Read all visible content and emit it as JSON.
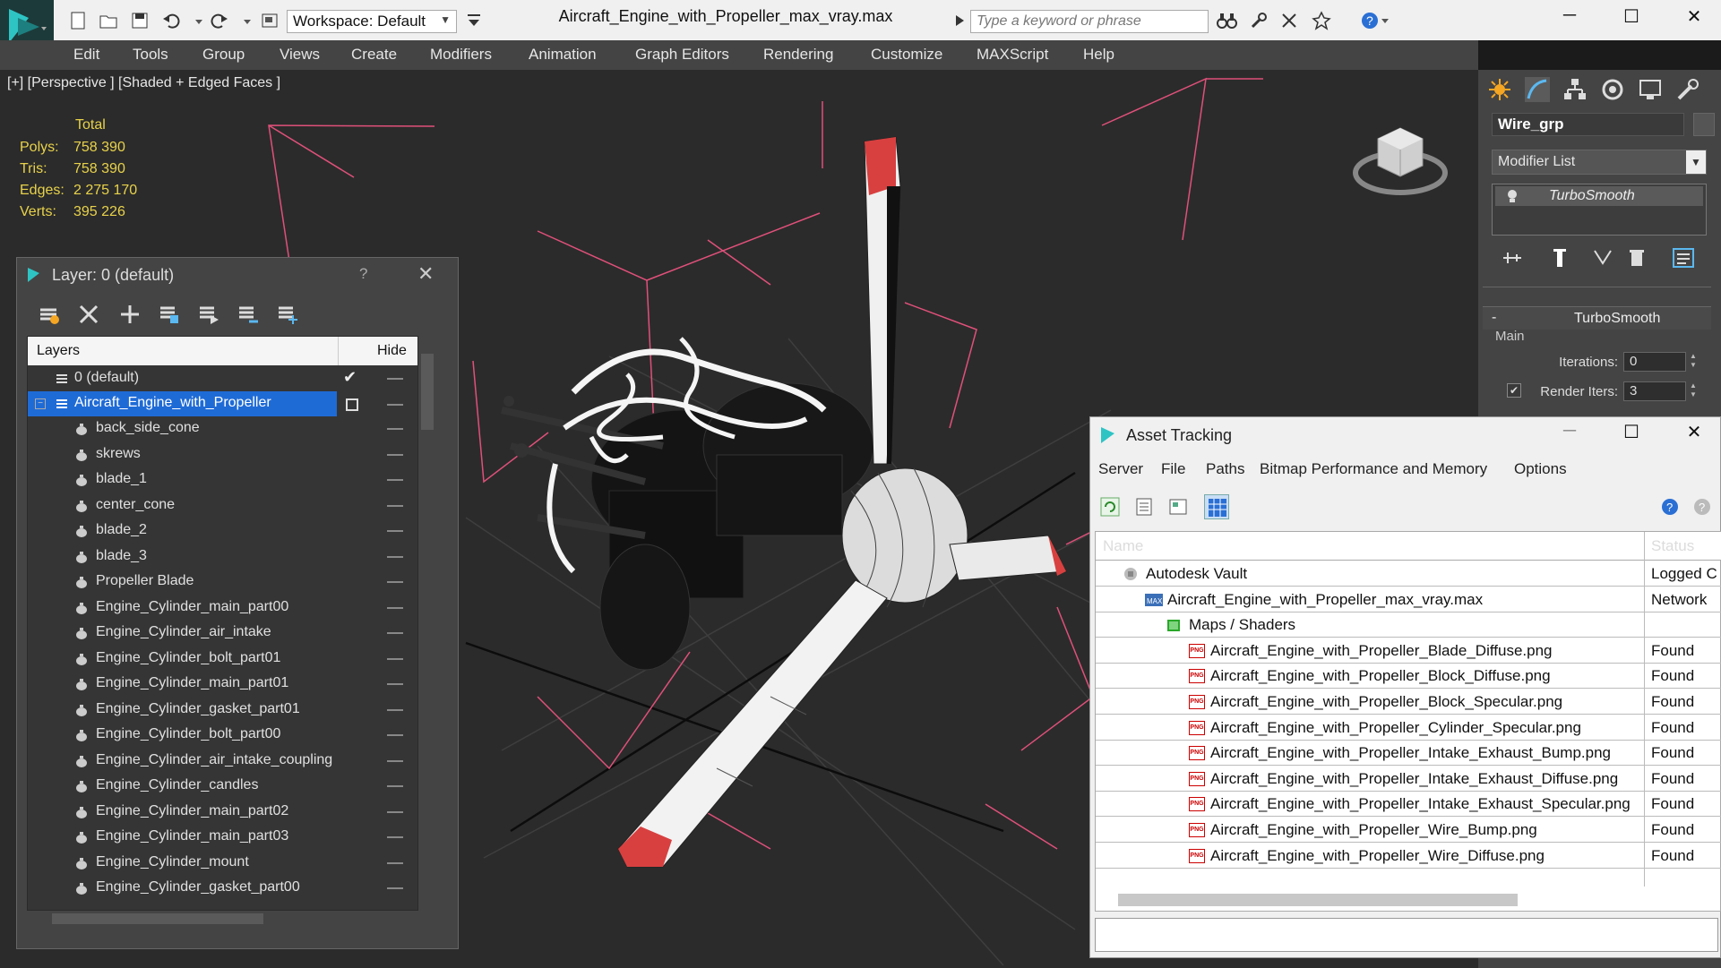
{
  "app": {
    "window_title": "Aircraft_Engine_with_Propeller_max_vray.max",
    "workspace_label": "Workspace: Default",
    "search_placeholder": "Type a keyword or phrase"
  },
  "menu": [
    "Edit",
    "Tools",
    "Group",
    "Views",
    "Create",
    "Modifiers",
    "Animation",
    "Graph Editors",
    "Rendering",
    "Customize",
    "MAXScript",
    "Help"
  ],
  "viewport": {
    "label": "[+] [Perspective ] [Shaded + Edged Faces ]",
    "stats": {
      "header": "Total",
      "rows": [
        {
          "label": "Polys:",
          "value": "758 390"
        },
        {
          "label": "Tris:",
          "value": "758 390"
        },
        {
          "label": "Edges:",
          "value": "2 275 170"
        },
        {
          "label": "Verts:",
          "value": "395 226"
        }
      ]
    }
  },
  "command_panel": {
    "object_name": "Wire_grp",
    "modifier_list": "Modifier List",
    "stack_item": "TurboSmooth",
    "rollout_title": "TurboSmooth",
    "group_label": "Main",
    "iterations_label": "Iterations:",
    "iterations_value": "0",
    "render_iters_label": "Render Iters:",
    "render_iters_value": "3"
  },
  "layer_window": {
    "title": "Layer: 0 (default)",
    "help": "?",
    "col_layers": "Layers",
    "col_hide": "Hide",
    "default_layer": "0 (default)",
    "selected_layer": "Aircraft_Engine_with_Propeller",
    "children": [
      "back_side_cone",
      "skrews",
      "blade_1",
      "center_cone",
      "blade_2",
      "blade_3",
      "Propeller Blade",
      "Engine_Cylinder_main_part00",
      "Engine_Cylinder_air_intake",
      "Engine_Cylinder_bolt_part01",
      "Engine_Cylinder_main_part01",
      "Engine_Cylinder_gasket_part01",
      "Engine_Cylinder_bolt_part00",
      "Engine_Cylinder_air_intake_coupling",
      "Engine_Cylinder_candles",
      "Engine_Cylinder_main_part02",
      "Engine_Cylinder_main_part03",
      "Engine_Cylinder_mount",
      "Engine_Cylinder_gasket_part00"
    ]
  },
  "asset_window": {
    "title": "Asset Tracking",
    "menu": [
      "Server",
      "File",
      "Paths",
      "Bitmap Performance and Memory",
      "Options"
    ],
    "col_name": "Name",
    "col_status": "Status",
    "rows": [
      {
        "name": "Autodesk Vault",
        "status": "Logged C",
        "indent": 0,
        "icon": "vault"
      },
      {
        "name": "Aircraft_Engine_with_Propeller_max_vray.max",
        "status": "Network",
        "indent": 1,
        "icon": "max"
      },
      {
        "name": "Maps / Shaders",
        "status": "",
        "indent": 2,
        "icon": "folder"
      },
      {
        "name": "Aircraft_Engine_with_Propeller_Blade_Diffuse.png",
        "status": "Found",
        "indent": 3,
        "icon": "png"
      },
      {
        "name": "Aircraft_Engine_with_Propeller_Block_Diffuse.png",
        "status": "Found",
        "indent": 3,
        "icon": "png"
      },
      {
        "name": "Aircraft_Engine_with_Propeller_Block_Specular.png",
        "status": "Found",
        "indent": 3,
        "icon": "png"
      },
      {
        "name": "Aircraft_Engine_with_Propeller_Cylinder_Specular.png",
        "status": "Found",
        "indent": 3,
        "icon": "png"
      },
      {
        "name": "Aircraft_Engine_with_Propeller_Intake_Exhaust_Bump.png",
        "status": "Found",
        "indent": 3,
        "icon": "png"
      },
      {
        "name": "Aircraft_Engine_with_Propeller_Intake_Exhaust_Diffuse.png",
        "status": "Found",
        "indent": 3,
        "icon": "png"
      },
      {
        "name": "Aircraft_Engine_with_Propeller_Intake_Exhaust_Specular.png",
        "status": "Found",
        "indent": 3,
        "icon": "png"
      },
      {
        "name": "Aircraft_Engine_with_Propeller_Wire_Bump.png",
        "status": "Found",
        "indent": 3,
        "icon": "png"
      },
      {
        "name": "Aircraft_Engine_with_Propeller_Wire_Diffuse.png",
        "status": "Found",
        "indent": 3,
        "icon": "png"
      }
    ]
  },
  "colors": {
    "accent_selection": "#1f6bd6",
    "viewport_bg": "#2b2b2b",
    "stats_text": "#e8d24a",
    "bbox_lines": "#e0507a"
  }
}
